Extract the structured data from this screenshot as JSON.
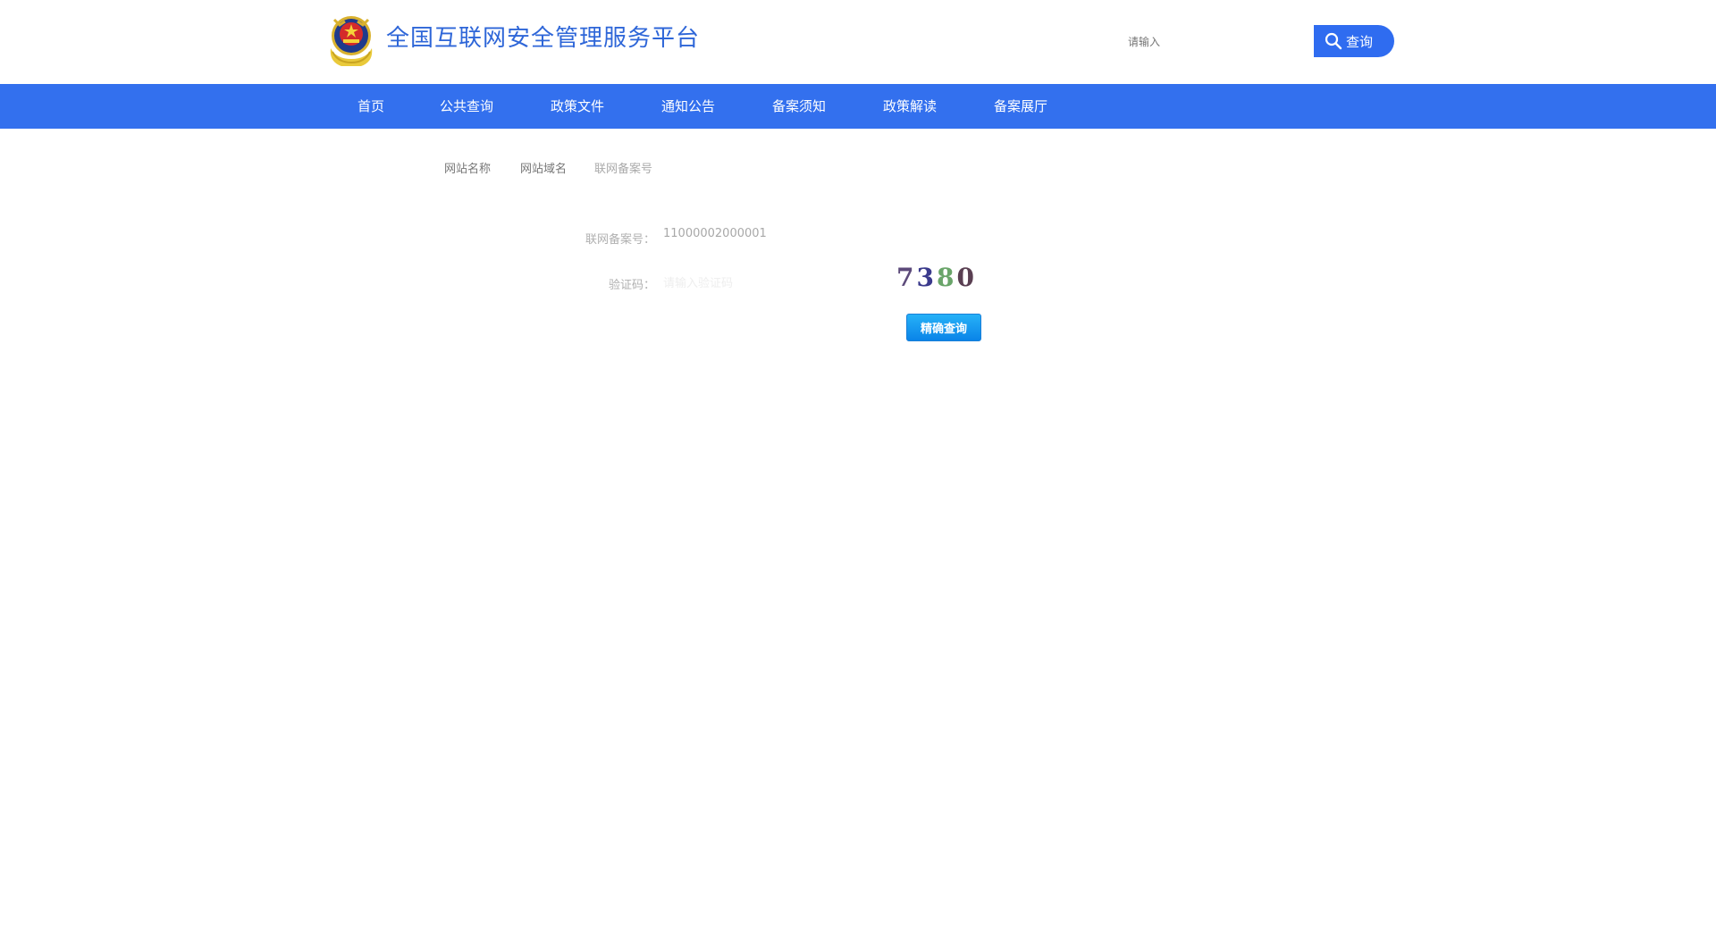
{
  "header": {
    "title": "全国互联网安全管理服务平台",
    "search_placeholder": "请输入",
    "search_button": "查询"
  },
  "nav": [
    {
      "label": "首页"
    },
    {
      "label": "公共查询"
    },
    {
      "label": "政策文件"
    },
    {
      "label": "通知公告"
    },
    {
      "label": "备案须知"
    },
    {
      "label": "政策解读"
    },
    {
      "label": "备案展厅"
    }
  ],
  "tabs": [
    {
      "label": "网站名称"
    },
    {
      "label": "网站域名"
    },
    {
      "label": "联网备案号"
    }
  ],
  "form": {
    "record_label": "联网备案号：",
    "record_value": "11000002000001",
    "captcha_label": "验证码：",
    "captcha_placeholder": "请输入验证码",
    "captcha_digits": [
      {
        "char": "7",
        "color": "#5c4a7a"
      },
      {
        "char": "3",
        "color": "#3b3a8c"
      },
      {
        "char": "8",
        "color": "#6aa56a"
      },
      {
        "char": "0",
        "color": "#5a3f52"
      }
    ],
    "submit_label": "精确查询"
  },
  "colors": {
    "brand_blue": "#3370ee",
    "title_blue": "#2e66d8",
    "button_blue": "#0a84e8"
  }
}
